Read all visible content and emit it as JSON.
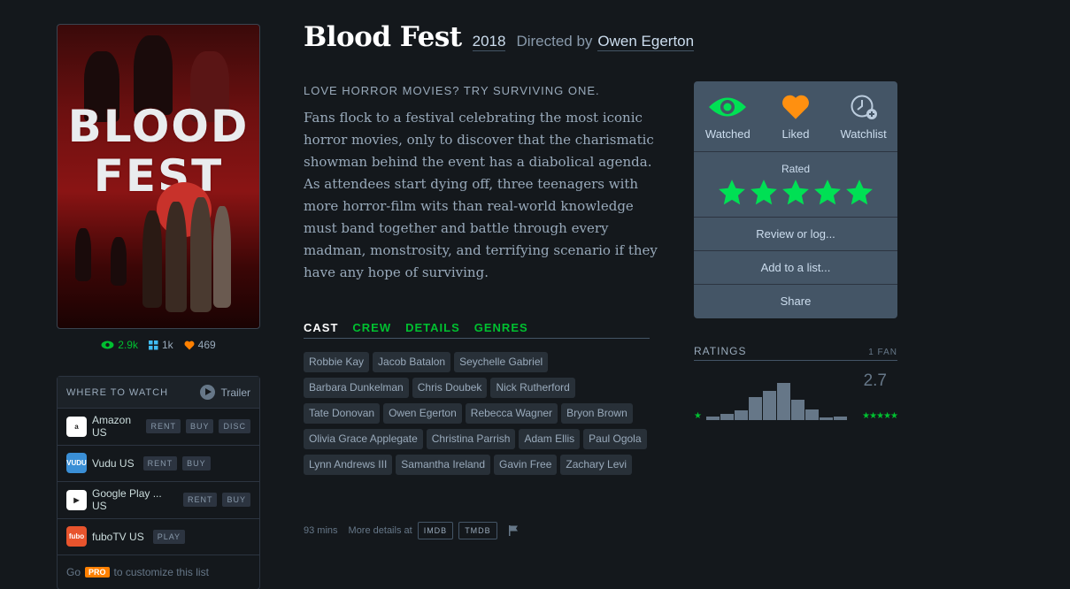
{
  "poster": {
    "title_line1": "BLOOD",
    "title_line2": "FEST"
  },
  "stats": {
    "watched": "2.9k",
    "lists": "1k",
    "likes": "469"
  },
  "where_to_watch": {
    "heading": "WHERE TO WATCH",
    "trailer": "Trailer",
    "services": [
      {
        "name": "Amazon US",
        "logo": "a",
        "color": "#ffffff",
        "tags": [
          "RENT",
          "BUY",
          "DISC"
        ]
      },
      {
        "name": "Vudu US",
        "logo": "VUDU",
        "color": "#3a8fd6",
        "tags": [
          "RENT",
          "BUY"
        ]
      },
      {
        "name": "Google Play ...  US",
        "logo": "▶",
        "color": "#ffffff",
        "tags": [
          "RENT",
          "BUY"
        ]
      },
      {
        "name": "fuboTV US",
        "logo": "fubo",
        "color": "#e8542d",
        "tags": [
          "PLAY"
        ]
      }
    ],
    "footer_pre": "Go",
    "footer_badge": "PRO",
    "footer_post": "to customize this list"
  },
  "film": {
    "title": "Blood Fest",
    "year": "2018",
    "directed_by": "Directed by",
    "director": "Owen Egerton",
    "tagline": "LOVE HORROR MOVIES? TRY SURVIVING ONE.",
    "synopsis": "Fans flock to a festival celebrating the most iconic horror movies, only to discover that the charismatic showman behind the event has a diabolical agenda. As attendees start dying off, three teenagers with more horror-film wits than real-world knowledge must band together and battle through every madman, monstrosity, and terrifying scenario if they have any hope of surviving."
  },
  "tabs": [
    "CAST",
    "CREW",
    "DETAILS",
    "GENRES"
  ],
  "cast": [
    "Robbie Kay",
    "Jacob Batalon",
    "Seychelle Gabriel",
    "Barbara Dunkelman",
    "Chris Doubek",
    "Nick Rutherford",
    "Tate Donovan",
    "Owen Egerton",
    "Rebecca Wagner",
    "Bryon Brown",
    "Olivia Grace Applegate",
    "Christina Parrish",
    "Adam Ellis",
    "Paul Ogola",
    "Lynn Andrews III",
    "Samantha Ireland",
    "Gavin Free",
    "Zachary Levi"
  ],
  "meta": {
    "runtime": "93 mins",
    "more_details": "More details at",
    "imdb": "IMDB",
    "tmdb": "TMDB"
  },
  "actions": {
    "watched": "Watched",
    "liked": "Liked",
    "watchlist": "Watchlist",
    "rated_label": "Rated",
    "rating_stars": 5,
    "review": "Review or log...",
    "add_list": "Add to a list...",
    "share": "Share"
  },
  "ratings": {
    "heading": "RATINGS",
    "fans": "1 FAN",
    "average": "2.7",
    "low_label": "★",
    "high_label": "★★★★★",
    "histogram": [
      0.08,
      0.17,
      0.24,
      0.58,
      0.76,
      0.95,
      0.52,
      0.28,
      0.06,
      0.08
    ]
  },
  "colors": {
    "green": "#00c030",
    "orange": "#ff8000",
    "blue": "#40bcf4",
    "panel": "#445566",
    "bg": "#14181c"
  }
}
